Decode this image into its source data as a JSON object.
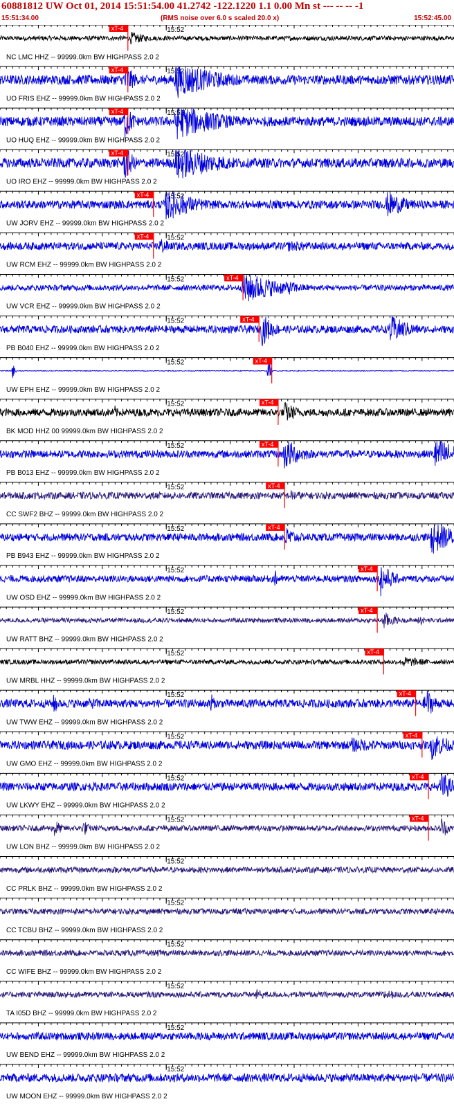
{
  "header": {
    "title": "60881812 UW Oct 01, 2014 15:51:54.00   41.2742 -122.1220  1.1 0.00 Mn st --- -- --  -1",
    "start_time": "15:51:34.00",
    "note": "(RMS noise over 6.0 s scaled 20.0 x)",
    "end_time": "15:52:45.00"
  },
  "chart_data": {
    "type": "line",
    "title": "60881812 UW Oct 01, 2014 15:51:54.00   41.2742 -122.1220  1.1 0.00 Mn st --- -- --  -1",
    "x_start": "15:51:34.00",
    "x_end": "15:52:45.00",
    "x_range_seconds": [
      0,
      71
    ],
    "minute_tick_label": "15:52",
    "minute_tick_second": 26,
    "grid": true,
    "pick_label": "xT-4",
    "colors": {
      "header": "#c00000",
      "pick": "#ff0000",
      "grid": "#000000"
    },
    "traces": [
      {
        "label": "NC LMC HHZ -- 99999.0km BW  HIGHPASS  2.0  2",
        "pick_s": 20.0,
        "color": "#000000",
        "noise": 0.12,
        "bursts": [
          [
            20.5,
            0.35,
            3.0
          ]
        ]
      },
      {
        "label": "UO FRIS EHZ -- 99999.0km BW  HIGHPASS  2.0  2",
        "pick_s": 20.0,
        "color": "#0000dd",
        "noise": 0.25,
        "bursts": [
          [
            19.5,
            1.0,
            1.5
          ],
          [
            27.5,
            1.0,
            7.5
          ]
        ]
      },
      {
        "label": "UO HUQ EHZ -- 99999.0km BW  HIGHPASS  2.0  2",
        "pick_s": 20.0,
        "color": "#0000dd",
        "noise": 0.25,
        "bursts": [
          [
            19.5,
            1.0,
            1.5
          ],
          [
            27.5,
            1.0,
            7.5
          ]
        ]
      },
      {
        "label": "UO IRO EHZ -- 99999.0km BW  HIGHPASS  2.0  2",
        "pick_s": 20.0,
        "color": "#0000dd",
        "noise": 0.25,
        "bursts": [
          [
            19.5,
            1.0,
            1.5
          ],
          [
            27.5,
            1.0,
            7.5
          ]
        ]
      },
      {
        "label": "UW JORV EHZ -- 99999.0km BW  HIGHPASS  2.0  2",
        "pick_s": 24.0,
        "color": "#0000dd",
        "noise": 0.22,
        "bursts": [
          [
            26.0,
            0.9,
            5.0
          ],
          [
            60.5,
            0.7,
            4.0
          ]
        ]
      },
      {
        "label": "UW RCM EHZ -- 99999.0km BW  HIGHPASS  2.0  2",
        "pick_s": 24.0,
        "color": "#0000dd",
        "noise": 0.2,
        "bursts": [
          [
            25.0,
            0.5,
            2.0
          ],
          [
            45.0,
            0.3,
            10.0
          ]
        ]
      },
      {
        "label": "UW VCR EHZ -- 99999.0km BW  HIGHPASS  2.0  2",
        "pick_s": 38.0,
        "color": "#0000dd",
        "noise": 0.15,
        "bursts": [
          [
            38.0,
            0.95,
            6.0
          ],
          [
            45.0,
            0.4,
            3.0
          ]
        ]
      },
      {
        "label": "PB B040 EHZ -- 99999.0km BW  HIGHPASS  2.0  2",
        "pick_s": 40.5,
        "color": "#0000dd",
        "noise": 0.2,
        "bursts": [
          [
            41.0,
            0.9,
            2.0
          ],
          [
            61.0,
            0.8,
            3.5
          ]
        ]
      },
      {
        "label": "UW EPH EHZ -- 99999.0km BW  HIGHPASS  2.0  2",
        "pick_s": 42.5,
        "color": "#0000dd",
        "noise": 0.02,
        "bursts": [
          [
            42.0,
            0.7,
            0.3
          ],
          [
            2.0,
            0.5,
            0.3
          ]
        ]
      },
      {
        "label": "BK MOD HHZ 00 99999.0km BW  HIGHPASS  2.0  2",
        "pick_s": 43.5,
        "color": "#000000",
        "noise": 0.2,
        "bursts": [
          [
            44.5,
            0.6,
            2.5
          ],
          [
            18.0,
            0.4,
            0.6
          ]
        ]
      },
      {
        "label": "PB B013 EHZ -- 99999.0km BW  HIGHPASS  2.0  2",
        "pick_s": 43.5,
        "color": "#0000dd",
        "noise": 0.2,
        "bursts": [
          [
            44.5,
            0.9,
            3.0
          ],
          [
            68.0,
            0.95,
            4.5
          ]
        ]
      },
      {
        "label": "CC SWF2 BHZ -- 99999.0km BW  HIGHPASS  2.0  2",
        "pick_s": 44.5,
        "color": "#2b1a7a",
        "noise": 0.18,
        "bursts": [
          [
            45.5,
            0.3,
            4.0
          ]
        ]
      },
      {
        "label": "PB B943 EHZ -- 99999.0km BW  HIGHPASS  2.0  2",
        "pick_s": 44.5,
        "color": "#0000dd",
        "noise": 0.2,
        "bursts": [
          [
            44.5,
            0.6,
            2.5
          ],
          [
            67.5,
            0.95,
            4.5
          ]
        ]
      },
      {
        "label": "UW OSD EHZ -- 99999.0km BW  HIGHPASS  2.0  2",
        "pick_s": 59.0,
        "color": "#0000dd",
        "noise": 0.18,
        "bursts": [
          [
            59.5,
            0.95,
            2.0
          ],
          [
            43.0,
            0.5,
            0.8
          ]
        ]
      },
      {
        "label": "UW RATT BHZ -- 99999.0km BW  HIGHPASS  2.0  2",
        "pick_s": 59.0,
        "color": "#2b1a7a",
        "noise": 0.12,
        "bursts": [
          [
            60.0,
            0.5,
            2.0
          ],
          [
            65.5,
            0.3,
            1.5
          ]
        ]
      },
      {
        "label": "UW MRBL HHZ -- 99999.0km BW  HIGHPASS  2.0  2",
        "pick_s": 60.0,
        "color": "#000000",
        "noise": 0.12,
        "bursts": [
          [
            63.0,
            0.3,
            5.0
          ]
        ]
      },
      {
        "label": "UW TWW EHZ -- 99999.0km BW  HIGHPASS  2.0  2",
        "pick_s": 65.0,
        "color": "#0000dd",
        "noise": 0.22,
        "bursts": [
          [
            66.5,
            0.95,
            1.5
          ],
          [
            8.5,
            0.8,
            0.5
          ],
          [
            33.0,
            0.9,
            0.4
          ],
          [
            14.0,
            0.3,
            8.0
          ]
        ]
      },
      {
        "label": "UW GMO EHZ -- 99999.0km BW  HIGHPASS  2.0  2",
        "pick_s": 66.0,
        "color": "#0000dd",
        "noise": 0.22,
        "bursts": [
          [
            67.5,
            0.8,
            3.0
          ],
          [
            55.0,
            0.4,
            8.0
          ]
        ]
      },
      {
        "label": "UW LKWY EHZ -- 99999.0km BW  HIGHPASS  2.0  2",
        "pick_s": 67.0,
        "color": "#0000dd",
        "noise": 0.22,
        "bursts": [
          [
            69.0,
            0.9,
            2.0
          ]
        ]
      },
      {
        "label": "UW LON BHZ -- 99999.0km BW  HIGHPASS  2.0  2",
        "pick_s": 67.0,
        "color": "#2b1a7a",
        "noise": 0.15,
        "bursts": [
          [
            69.0,
            0.7,
            1.0
          ],
          [
            8.5,
            0.6,
            1.0
          ],
          [
            13.0,
            0.5,
            1.0
          ]
        ]
      },
      {
        "label": "CC PRLK BHZ -- 99999.0km BW  HIGHPASS  2.0  2",
        "pick_s": null,
        "color": "#2b1a7a",
        "noise": 0.15,
        "bursts": []
      },
      {
        "label": "CC TCBU BHZ -- 99999.0km BW  HIGHPASS  2.0  2",
        "pick_s": null,
        "color": "#2b1a7a",
        "noise": 0.15,
        "bursts": []
      },
      {
        "label": "CC WIFE BHZ -- 99999.0km BW  HIGHPASS  2.0  2",
        "pick_s": null,
        "color": "#2b1a7a",
        "noise": 0.15,
        "bursts": []
      },
      {
        "label": "TA I05D BHZ -- 99999.0km BW  HIGHPASS  2.0  2",
        "pick_s": null,
        "color": "#2b1a7a",
        "noise": 0.15,
        "bursts": [
          [
            40.0,
            0.3,
            3.0
          ],
          [
            60.0,
            0.3,
            3.0
          ]
        ]
      },
      {
        "label": "UW BEND EHZ -- 99999.0km BW  HIGHPASS  2.0  2",
        "pick_s": null,
        "color": "#0000dd",
        "noise": 0.2,
        "bursts": []
      },
      {
        "label": "UW MOON EHZ -- 99999.0km BW  HIGHPASS  2.0  2",
        "pick_s": null,
        "color": "#0000dd",
        "noise": 0.22,
        "bursts": []
      }
    ]
  }
}
